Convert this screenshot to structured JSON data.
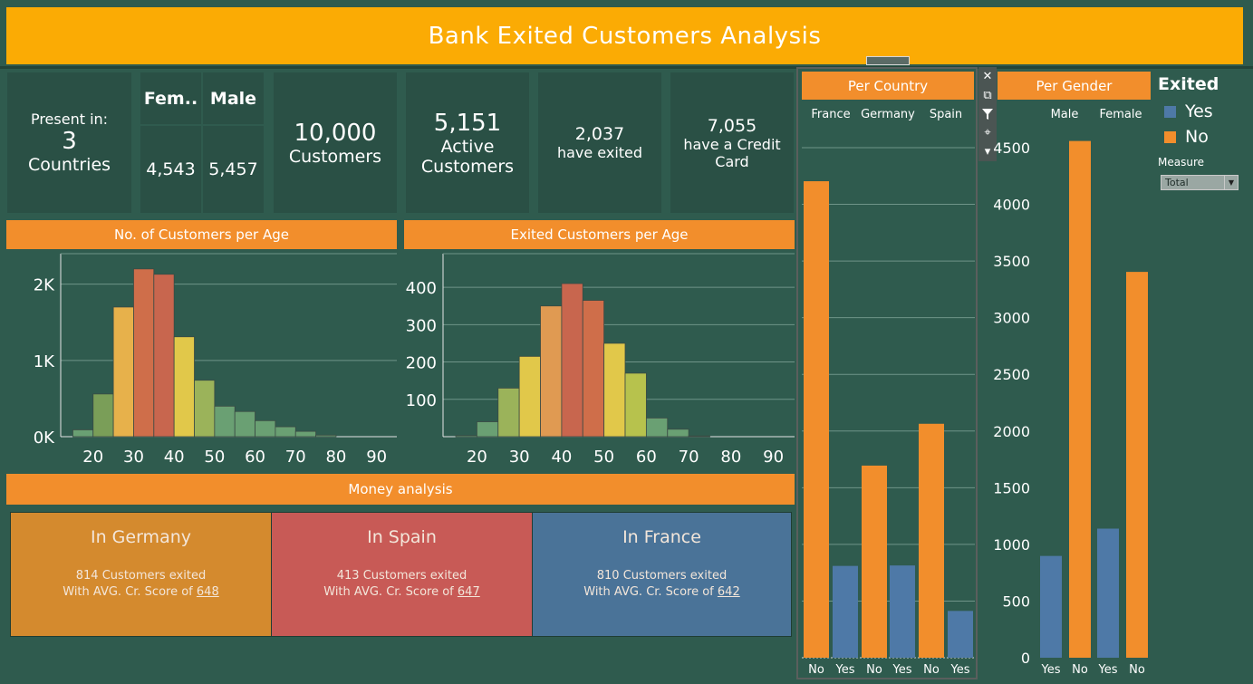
{
  "header": {
    "title": "Bank Exited Customers Analysis"
  },
  "kpis": {
    "present_label": "Present in:",
    "present_value": "3",
    "present_unit": "Countries",
    "gender_female_label": "Fem..",
    "gender_male_label": "Male",
    "gender_female_value": "4,543",
    "gender_male_value": "5,457",
    "customers_value": "10,000",
    "customers_label": "Customers",
    "active_value": "5,151",
    "active_label_1": "Active",
    "active_label_2": "Customers",
    "exited_value": "2,037",
    "exited_label": "have exited",
    "credit_value": "7,055",
    "credit_label_1": "have a Credit",
    "credit_label_2": "Card"
  },
  "titles": {
    "age_all": "No. of Customers per Age",
    "age_exited": "Exited Customers per Age",
    "money": "Money analysis",
    "per_country": "Per Country",
    "per_gender": "Per Gender"
  },
  "money": [
    {
      "place": "In Germany",
      "exited": "814",
      "exited_text": "Customers exited",
      "score_text": "With AVG. Cr. Score of",
      "score": "648",
      "color": "#d48a2e"
    },
    {
      "place": "In Spain",
      "exited": "413",
      "exited_text": "Customers exited",
      "score_text": "With AVG. Cr. Score of",
      "score": "647",
      "color": "#c85a56"
    },
    {
      "place": "In France",
      "exited": "810",
      "exited_text": "Customers exited",
      "score_text": "With AVG. Cr. Score of",
      "score": "642",
      "color": "#4a7398"
    }
  ],
  "legend": {
    "title": "Exited",
    "items": [
      {
        "label": "Yes",
        "color": "#4e79a7"
      },
      {
        "label": "No",
        "color": "#f28e2c"
      }
    ],
    "measure_label": "Measure",
    "measure_value": "Total"
  },
  "toolbar": {
    "icons": [
      "close-icon",
      "popout-icon",
      "filter-icon",
      "pin-icon",
      "more-icon"
    ]
  },
  "chart_data": [
    {
      "type": "bar",
      "title": "No. of Customers per Age",
      "x_ticks": [
        "20",
        "30",
        "40",
        "50",
        "60",
        "70",
        "80",
        "90"
      ],
      "y_ticks": [
        "0K",
        "1K",
        "2K"
      ],
      "bin_starts": [
        15,
        20,
        25,
        30,
        35,
        40,
        45,
        50,
        55,
        60,
        65,
        70,
        75,
        80,
        85
      ],
      "values": [
        90,
        560,
        1700,
        2200,
        2130,
        1310,
        740,
        400,
        330,
        210,
        130,
        70,
        20,
        0,
        0
      ],
      "colors": [
        "#6aa073",
        "#7a9e58",
        "#e7b14b",
        "#cf6e4a",
        "#c8664e",
        "#e1c84a",
        "#9bb35a",
        "#6aa073",
        "#6aa073",
        "#6aa073",
        "#6aa073",
        "#6aa073",
        "#6aa073",
        "#6aa073",
        "#6aa073"
      ],
      "xlim": [
        12,
        95
      ],
      "ylim": [
        0,
        2400
      ]
    },
    {
      "type": "bar",
      "title": "Exited Customers per Age",
      "x_ticks": [
        "20",
        "30",
        "40",
        "50",
        "60",
        "70",
        "80",
        "90"
      ],
      "y_ticks": [
        "100",
        "200",
        "300",
        "400"
      ],
      "bin_starts": [
        15,
        20,
        25,
        30,
        35,
        40,
        45,
        50,
        55,
        60,
        65,
        70,
        75,
        80,
        85
      ],
      "values": [
        3,
        40,
        130,
        215,
        350,
        410,
        365,
        250,
        170,
        50,
        20,
        2,
        0,
        0,
        0
      ],
      "colors": [
        "#6aa073",
        "#6aa073",
        "#9bb35a",
        "#e1c84a",
        "#e09a52",
        "#c8664e",
        "#cf6e4a",
        "#e1c84a",
        "#b7c24d",
        "#6aa073",
        "#6aa073",
        "#6aa073",
        "#6aa073",
        "#6aa073",
        "#6aa073"
      ],
      "xlim": [
        12,
        95
      ],
      "ylim": [
        0,
        490
      ]
    },
    {
      "type": "bar",
      "title": "Per Country",
      "groups": [
        "France",
        "Germany",
        "Spain"
      ],
      "x_labels": [
        "No",
        "Yes",
        "No",
        "Yes",
        "No",
        "Yes"
      ],
      "values": [
        4204,
        810,
        1695,
        814,
        2064,
        413
      ],
      "bar_colors": [
        "#f28e2c",
        "#4e79a7",
        "#f28e2c",
        "#4e79a7",
        "#f28e2c",
        "#4e79a7"
      ],
      "ylim": [
        0,
        4500
      ]
    },
    {
      "type": "bar",
      "title": "Per Gender",
      "groups": [
        "Male",
        "Female"
      ],
      "x_labels": [
        "Yes",
        "No",
        "Yes",
        "No"
      ],
      "values": [
        898,
        4559,
        1139,
        3404
      ],
      "bar_colors": [
        "#4e79a7",
        "#f28e2c",
        "#4e79a7",
        "#f28e2c"
      ],
      "y_ticks": [
        "0",
        "500",
        "1000",
        "1500",
        "2000",
        "2500",
        "3000",
        "3500",
        "4000",
        "4500"
      ],
      "ylim": [
        0,
        4500
      ]
    }
  ]
}
